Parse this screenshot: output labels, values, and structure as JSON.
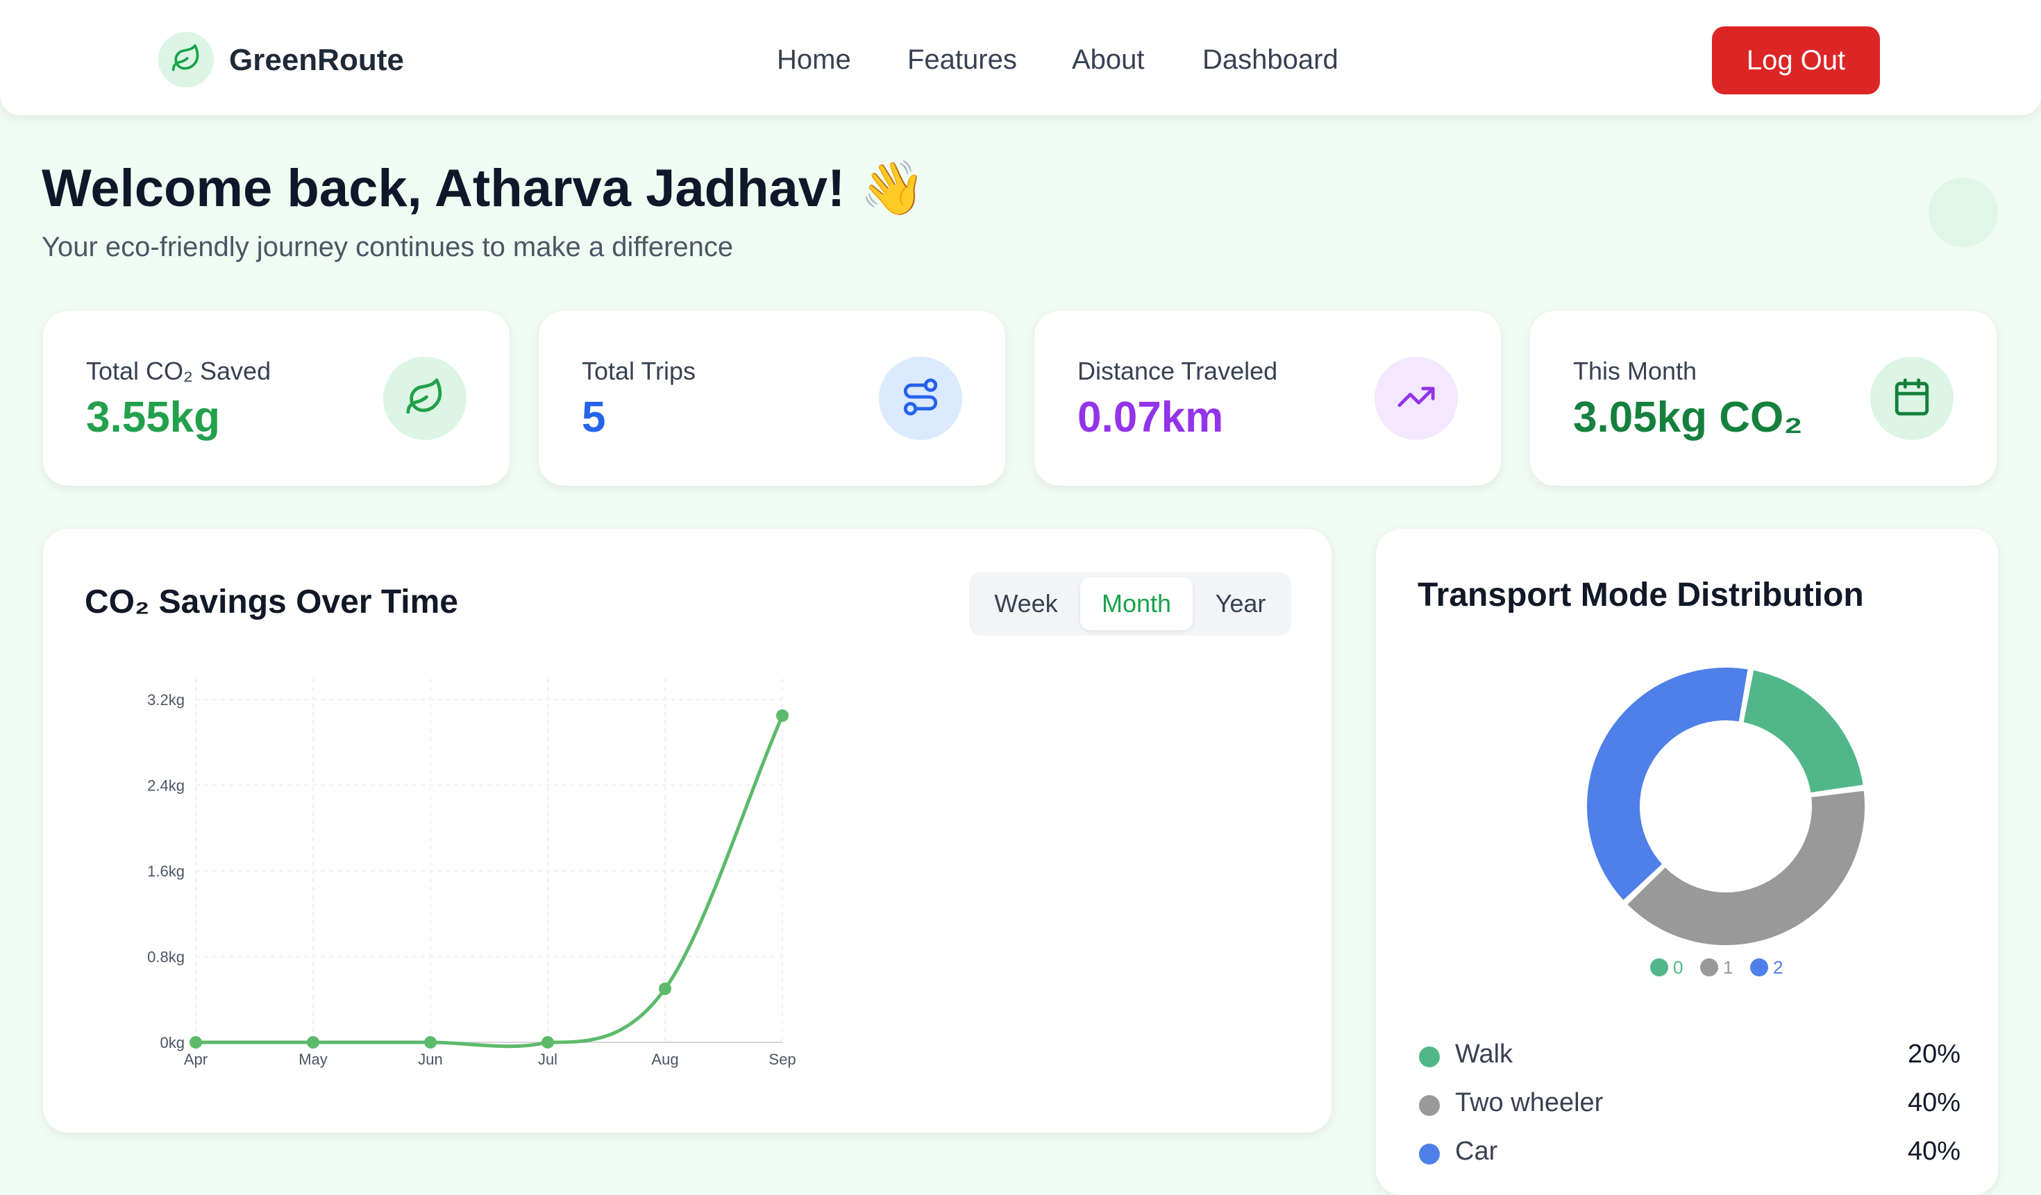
{
  "navbar": {
    "brand": "GreenRoute",
    "links": [
      "Home",
      "Features",
      "About",
      "Dashboard"
    ],
    "logout_label": "Log Out",
    "colors": {
      "logout": "#dc2626",
      "logo_bg": "#dcf5e4",
      "logo_icon": "#16a34a"
    },
    "logo_icon": "leaf-icon"
  },
  "header": {
    "welcome": "Welcome back, Atharva Jadhav! 👋",
    "subtitle": "Your eco-friendly journey continues to make a difference"
  },
  "stats": [
    {
      "label": "Total CO₂ Saved",
      "value": "3.55kg",
      "icon": "leaf-icon",
      "color": "#22a04b",
      "bg": "#dcf5e4"
    },
    {
      "label": "Total Trips",
      "value": "5",
      "icon": "route-icon",
      "color": "#2563eb",
      "bg": "#dbeafe"
    },
    {
      "label": "Distance Traveled",
      "value": "0.07km",
      "icon": "trending-up-icon",
      "color": "#9333ea",
      "bg": "#f3e8ff"
    },
    {
      "label": "This Month",
      "value": "3.05kg CO₂",
      "icon": "calendar-icon",
      "color": "#15803d",
      "bg": "#dcf5e4"
    }
  ],
  "savings_panel": {
    "title": "CO₂ Savings Over Time",
    "periods": [
      "Week",
      "Month",
      "Year"
    ],
    "active_period": "Month"
  },
  "distribution_panel": {
    "title": "Transport Mode Distribution",
    "legend": [
      {
        "name": "Walk",
        "pct": "20%",
        "color": "#52b788"
      },
      {
        "name": "Two wheeler",
        "pct": "40%",
        "color": "#999999"
      },
      {
        "name": "Car",
        "pct": "40%",
        "color": "#4f7fe8"
      }
    ]
  },
  "chart_data": [
    {
      "type": "line",
      "x": [
        "Apr",
        "May",
        "Jun",
        "Jul",
        "Aug",
        "Sep"
      ],
      "series": [
        {
          "values": [
            0,
            0,
            0,
            0,
            0.5,
            3.05
          ],
          "color": "#5cba6a"
        }
      ],
      "y_ticks": [
        "0kg",
        "0.8kg",
        "1.6kg",
        "2.4kg",
        "3.2kg"
      ],
      "ylim": [
        0,
        3.2
      ],
      "grid": true
    },
    {
      "type": "pie",
      "categories": [
        "0",
        "1",
        "2"
      ],
      "values": [
        20,
        40,
        40
      ],
      "colors": [
        "#52b788",
        "#999999",
        "#4f7fe8"
      ],
      "legend_position": "bottom"
    }
  ]
}
